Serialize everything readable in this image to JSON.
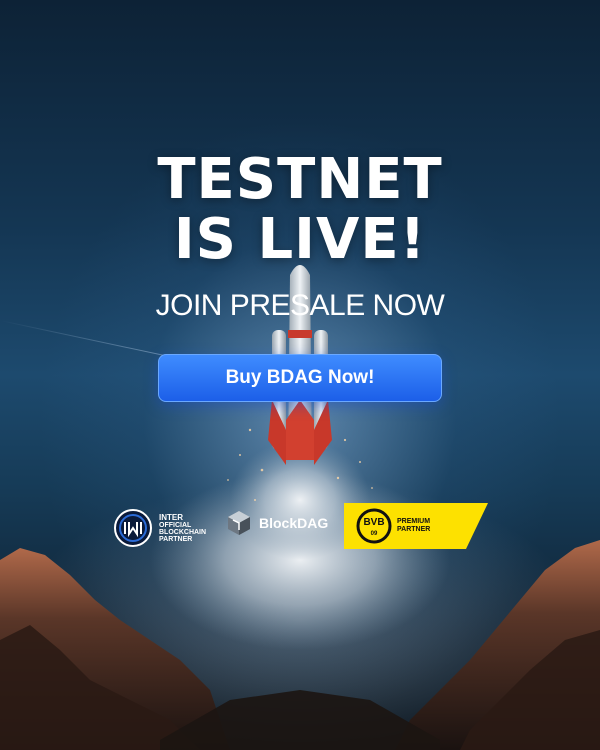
{
  "headline": {
    "line1": "TESTNET",
    "line2": "IS LIVE!"
  },
  "subheadline": "JOIN PRESALE NOW",
  "cta": {
    "label": "Buy BDAG Now!"
  },
  "partners": {
    "inter": {
      "line1": "INTER",
      "line2": "OFFICIAL",
      "line3": "BLOCKCHAIN",
      "line4": "PARTNER"
    },
    "blockdag": {
      "name": "BlockDAG"
    },
    "bvb": {
      "line1": "PREMIUM",
      "line2": "PARTNER"
    }
  },
  "colors": {
    "cta": "#1f63ee",
    "bvb_yellow": "#fde100",
    "background": "#143653"
  }
}
